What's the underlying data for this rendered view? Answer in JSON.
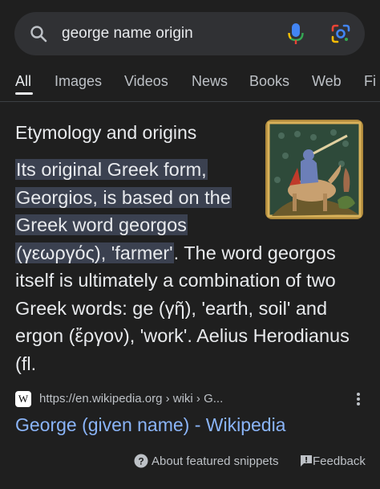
{
  "search": {
    "query": "george name origin",
    "icons": {
      "search": "search-icon",
      "mic": "microphone-icon",
      "lens": "google-lens-icon"
    }
  },
  "tabs": [
    {
      "label": "All",
      "active": true
    },
    {
      "label": "Images",
      "active": false
    },
    {
      "label": "Videos",
      "active": false
    },
    {
      "label": "News",
      "active": false
    },
    {
      "label": "Books",
      "active": false
    },
    {
      "label": "Web",
      "active": false
    },
    {
      "label": "Fi",
      "active": false
    }
  ],
  "snippet": {
    "heading": "Etymology and origins",
    "highlighted_lines": [
      "Its original Greek form,",
      "Georgios, is based on the",
      "Greek word georgos",
      "(γεωργός), 'farmer'"
    ],
    "continuation_first": ". The word georgos",
    "plain_lines": [
      "itself is ultimately a combination of two",
      "Greek words: ge (γῆ), 'earth, soil' and",
      "ergon (ἔργον), 'work'. Aelius Herodianus",
      "(fl."
    ],
    "image_alt": "medieval-illustration-thumbnail"
  },
  "source": {
    "favicon_letter": "W",
    "url": "https://en.wikipedia.org › wiki › G...",
    "title": "George (given name) - Wikipedia"
  },
  "footer": {
    "about": "About featured snippets",
    "feedback": "Feedback"
  },
  "colors": {
    "background": "#1f1f1f",
    "search_bar": "#303134",
    "highlight": "#3b4150",
    "link": "#8ab4f8",
    "mic_blue": "#4285f4"
  }
}
